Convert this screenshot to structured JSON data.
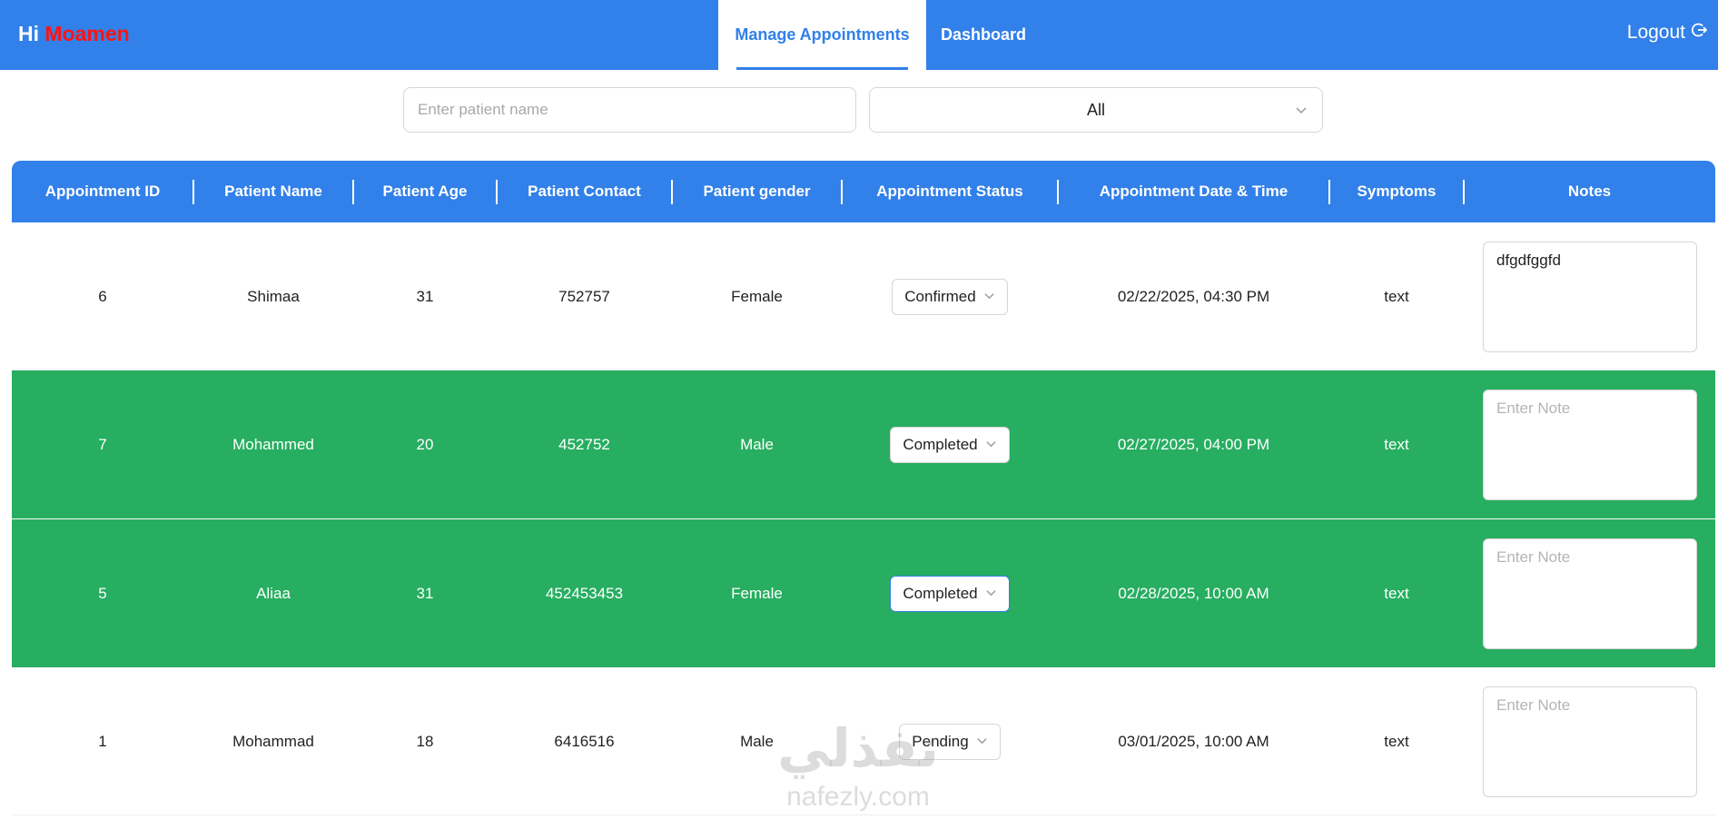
{
  "header": {
    "greeting": "Hi",
    "user_name": "Moamen",
    "tabs": [
      {
        "label": "Manage Appointments",
        "active": true
      },
      {
        "label": "Dashboard",
        "active": false
      }
    ],
    "logout_label": "Logout",
    "colors": {
      "primary": "#3280e9",
      "user_name": "#ff1414"
    }
  },
  "filters": {
    "search_placeholder": "Enter patient name",
    "search_value": "",
    "status_filter_value": "All"
  },
  "table": {
    "columns": [
      "Appointment ID",
      "Patient Name",
      "Patient Age",
      "Patient Contact",
      "Patient gender",
      "Appointment Status",
      "Appointment Date & Time",
      "Symptoms",
      "Notes"
    ],
    "rows": [
      {
        "id": "6",
        "name": "Shimaa",
        "age": "31",
        "contact": "752757",
        "gender": "Female",
        "status": "Confirmed",
        "datetime": "02/22/2025, 04:30 PM",
        "symptoms": "text",
        "note_value": "dfgdfggfd",
        "note_placeholder": "Enter Note"
      },
      {
        "id": "7",
        "name": "Mohammed",
        "age": "20",
        "contact": "452752",
        "gender": "Male",
        "status": "Completed",
        "datetime": "02/27/2025, 04:00 PM",
        "symptoms": "text",
        "note_value": "",
        "note_placeholder": "Enter Note"
      },
      {
        "id": "5",
        "name": "Aliaa",
        "age": "31",
        "contact": "452453453",
        "gender": "Female",
        "status": "Completed",
        "datetime": "02/28/2025, 10:00 AM",
        "symptoms": "text",
        "note_value": "",
        "note_placeholder": "Enter Note"
      },
      {
        "id": "1",
        "name": "Mohammad",
        "age": "18",
        "contact": "6416516",
        "gender": "Male",
        "status": "Pending",
        "datetime": "03/01/2025, 10:00 AM",
        "symptoms": "text",
        "note_value": "",
        "note_placeholder": "Enter Note"
      }
    ],
    "colors": {
      "completed_row": "#27ae60",
      "header_bg": "#3280e9"
    }
  },
  "watermark": {
    "arabic": "نفذلي",
    "latin": "nafezly.com"
  }
}
